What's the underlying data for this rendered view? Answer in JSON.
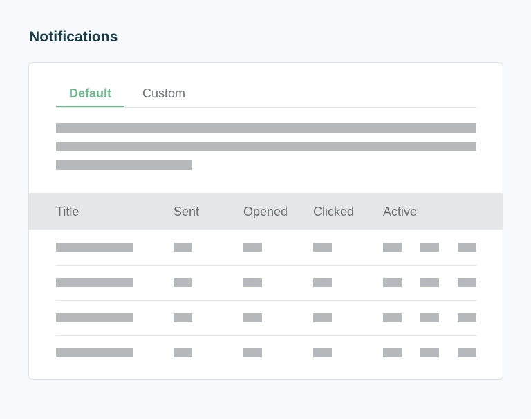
{
  "page": {
    "title": "Notifications"
  },
  "tabs": [
    {
      "label": "Default",
      "active": true
    },
    {
      "label": "Custom",
      "active": false
    }
  ],
  "table": {
    "columns": [
      "Title",
      "Sent",
      "Opened",
      "Clicked",
      "Active"
    ],
    "row_count": 4
  },
  "colors": {
    "accent": "#6bb88c",
    "title": "#173d48",
    "placeholder": "#b5b9bc",
    "header_bg": "#e5e6ea"
  }
}
